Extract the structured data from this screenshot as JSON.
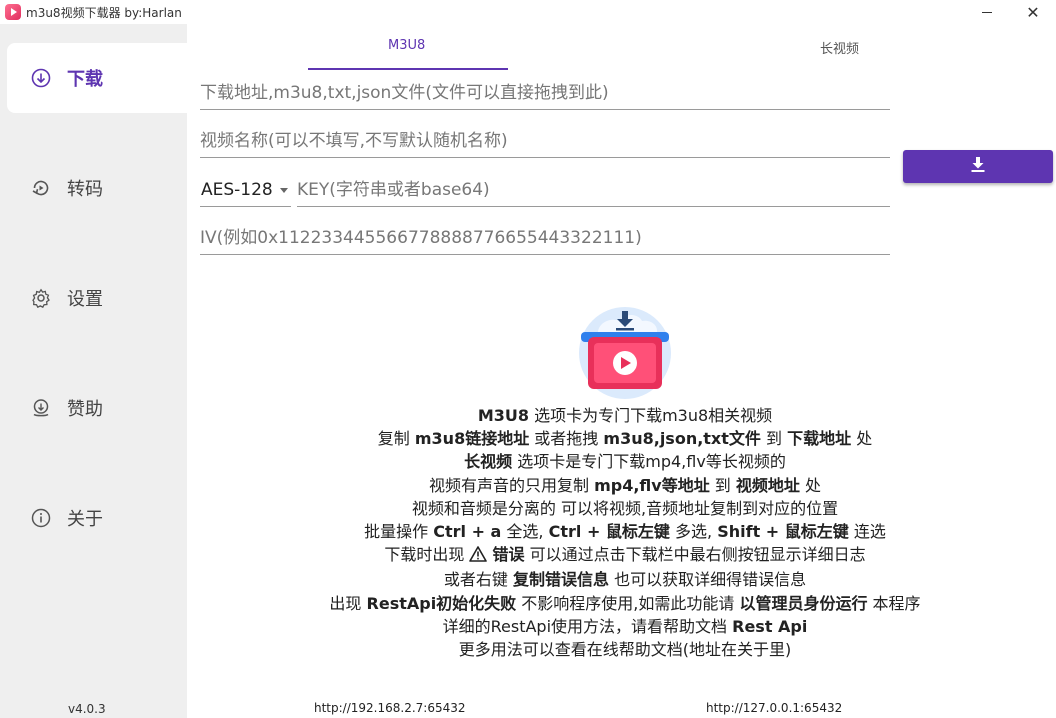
{
  "window": {
    "title": "m3u8视频下载器 by:Harlan",
    "minimize_icon": "minimize-icon",
    "close_label": "✕"
  },
  "sidebar": {
    "items": [
      {
        "label": "下载",
        "icon": "download-circle-icon",
        "active": true
      },
      {
        "label": "转码",
        "icon": "convert-icon",
        "active": false
      },
      {
        "label": "设置",
        "icon": "gear-icon",
        "active": false
      },
      {
        "label": "赞助",
        "icon": "sponsor-icon",
        "active": false
      },
      {
        "label": "关于",
        "icon": "info-icon",
        "active": false
      }
    ],
    "version": "v4.0.3"
  },
  "tabs": [
    {
      "label": "M3U8",
      "active": true
    },
    {
      "label": "长视频",
      "active": false
    }
  ],
  "form": {
    "url_placeholder": "下载地址,m3u8,txt,json文件(文件可以直接拖拽到此)",
    "name_placeholder": "视频名称(可以不填写,不写默认随机名称)",
    "cipher_selected": "AES-128",
    "key_placeholder": "KEY(字符串或者base64)",
    "iv_placeholder": "IV(例如0x112233445566778888776655443322111)",
    "download_button_icon": "download-icon"
  },
  "help": {
    "l1": {
      "b1": "M3U8",
      "t1": " 选项卡为专门下载m3u8相关视频"
    },
    "l2": {
      "t1": "复制 ",
      "b1": "m3u8链接地址",
      "t2": " 或者拖拽 ",
      "b2": "m3u8,json,txt文件",
      "t3": " 到 ",
      "b3": "下载地址",
      "t4": " 处"
    },
    "l3": {
      "b1": "长视频",
      "t1": " 选项卡是专门下载mp4,flv等长视频的"
    },
    "l4": {
      "t1": "视频有声音的只用复制 ",
      "b1": "mp4,flv等地址",
      "t2": " 到 ",
      "b2": "视频地址",
      "t3": " 处"
    },
    "l5": {
      "t1": "视频和音频是分离的 可以将视频,音频地址复制到对应的位置"
    },
    "l6": {
      "t1": "批量操作 ",
      "b1": "Ctrl + a",
      "t2": " 全选, ",
      "b2": "Ctrl + 鼠标左键",
      "t3": " 多选, ",
      "b3": "Shift + 鼠标左键",
      "t4": " 连选"
    },
    "l7": {
      "t1": "下载时出现 ",
      "b1": "错误",
      "t2": " 可以通过点击下载栏中最右侧按钮显示详细日志"
    },
    "l8": {
      "t1": "或者右键 ",
      "b1": "复制错误信息",
      "t2": " 也可以获取详细得错误信息"
    },
    "l9": {
      "t1": "出现 ",
      "b1": "RestApi初始化失败",
      "t2": " 不影响程序使用,如需此功能请 ",
      "b2": "以管理员身份运行",
      "t3": " 本程序"
    },
    "l10": {
      "t1": "详细的RestApi使用方法，请看帮助文档 ",
      "b1": "Rest Api"
    },
    "l11": {
      "t1": "更多用法可以查看在线帮助文档(地址在关于里)"
    }
  },
  "footer": {
    "api_local": "http://192.168.2.7:65432",
    "api_loopback": "http://127.0.0.1:65432"
  },
  "colors": {
    "accent": "#5e35b1",
    "sidebar_bg": "#efefef"
  }
}
